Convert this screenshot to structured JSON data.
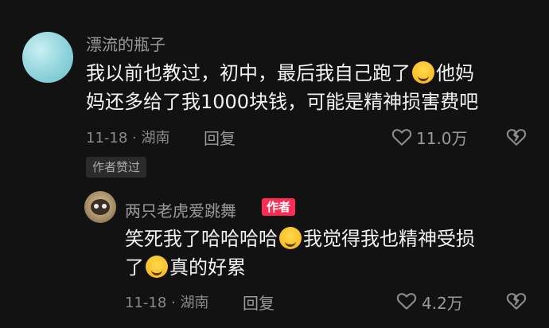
{
  "comment": {
    "username": "漂流的瓶子",
    "text_line1": "我以前也教过，初中，最后我自己跑了",
    "text_line1_tail": "他妈",
    "text_line2": "妈还多给了我1000块钱，可能是精神损害费吧",
    "date_location": "11-18 · 湖南",
    "reply_label": "回复",
    "likes": "11.0万",
    "praised_badge": "作者赞过",
    "emoji_icon": "grinning-sweat-emoji"
  },
  "reply": {
    "username": "两只老虎爱跳舞",
    "author_tag": "作者",
    "text_line1_a": "笑死我了哈哈哈哈",
    "text_line1_b": "我觉得我也精神受损",
    "text_line2_a": "了",
    "text_line2_b": "真的好累",
    "date_location": "11-18 · 湖南",
    "reply_label": "回复",
    "likes": "4.2万",
    "emoji_1": "hand-over-mouth-emoji",
    "emoji_2": "loudly-crying-emoji"
  },
  "colors": {
    "background": "#121212",
    "accent": "#fe2c55",
    "muted_text": "#9a9a9a"
  }
}
